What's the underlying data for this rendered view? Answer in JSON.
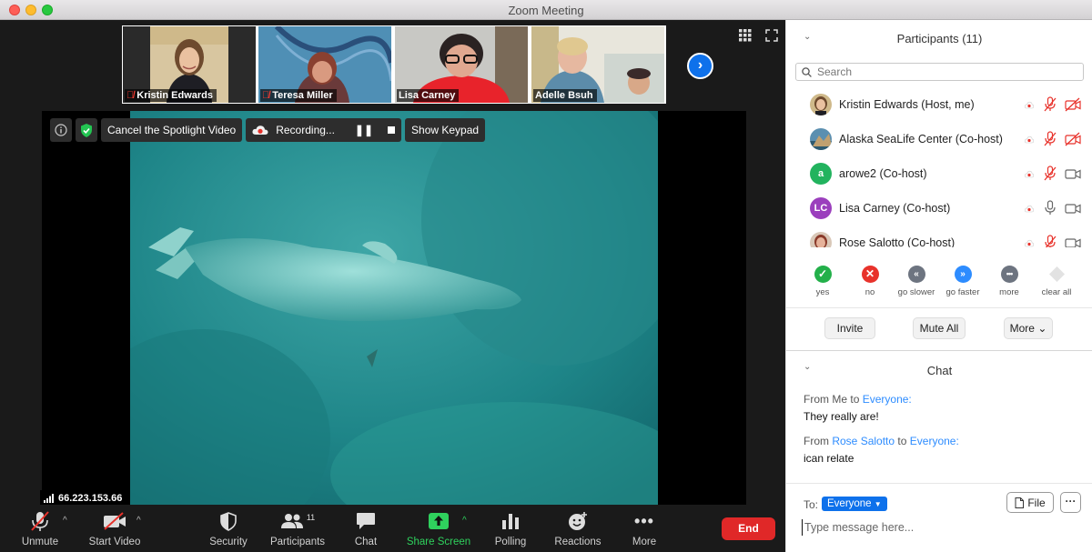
{
  "window": {
    "title": "Zoom Meeting"
  },
  "thumbnails": [
    {
      "name": "Kristin Edwards",
      "muted": true
    },
    {
      "name": "Teresa Miller",
      "muted": true
    },
    {
      "name": "Lisa Carney",
      "muted": false
    },
    {
      "name": "Adelle Bsuh",
      "muted": false
    }
  ],
  "spotlight_bar": {
    "cancel_label": "Cancel the Spotlight Video",
    "recording_label": "Recording...",
    "keypad_label": "Show Keypad"
  },
  "connection": {
    "ip": "66.223.153.66"
  },
  "toolbar": {
    "unmute": "Unmute",
    "start_video": "Start Video",
    "security": "Security",
    "participants": "Participants",
    "participants_count": "11",
    "chat": "Chat",
    "share_screen": "Share Screen",
    "polling": "Polling",
    "reactions": "Reactions",
    "more": "More",
    "end": "End"
  },
  "participants_panel": {
    "title": "Participants (11)",
    "search_placeholder": "Search",
    "participants": [
      {
        "name": "Kristin Edwards (Host, me)",
        "avatar_initials": "",
        "avatar_color": "#c98a6a",
        "mic": "muted",
        "video": "off"
      },
      {
        "name": "Alaska SeaLife Center (Co-host)",
        "avatar_initials": "",
        "avatar_color": "#3d6e8e",
        "mic": "muted",
        "video": "off"
      },
      {
        "name": "arowe2 (Co-host)",
        "avatar_initials": "a",
        "avatar_color": "#22b35e",
        "mic": "muted",
        "video": "on"
      },
      {
        "name": "Lisa Carney (Co-host)",
        "avatar_initials": "LC",
        "avatar_color": "#9b3fbd",
        "mic": "on",
        "video": "on"
      },
      {
        "name": "Rose Salotto (Co-host)",
        "avatar_initials": "",
        "avatar_color": "#a0524a",
        "mic": "muted",
        "video": "on"
      }
    ],
    "feedback": [
      {
        "label": "yes",
        "icon": "check-icon",
        "color": "#23b04a"
      },
      {
        "label": "no",
        "icon": "x-icon",
        "color": "#e8322b"
      },
      {
        "label": "go slower",
        "icon": "rewind-icon",
        "color": "#6d7480"
      },
      {
        "label": "go faster",
        "icon": "fast-forward-icon",
        "color": "#2d8cff"
      },
      {
        "label": "more",
        "icon": "ellipsis-icon",
        "color": "#6d7480"
      },
      {
        "label": "clear all",
        "icon": "diamond-icon",
        "color": "#d8d8d8"
      }
    ],
    "invite": "Invite",
    "mute_all": "Mute All",
    "more": "More"
  },
  "chat_panel": {
    "title": "Chat",
    "messages": [
      {
        "prefix": "From",
        "sender": "Me",
        "to_word": "to",
        "recipient": "Everyone:",
        "text": "They really are!"
      },
      {
        "prefix": "From",
        "sender": "Rose Salotto",
        "to_word": "to",
        "recipient": "Everyone:",
        "text": "ican relate"
      }
    ],
    "to_label": "To:",
    "to_value": "Everyone",
    "file_label": "File",
    "input_placeholder": "Type message here..."
  }
}
